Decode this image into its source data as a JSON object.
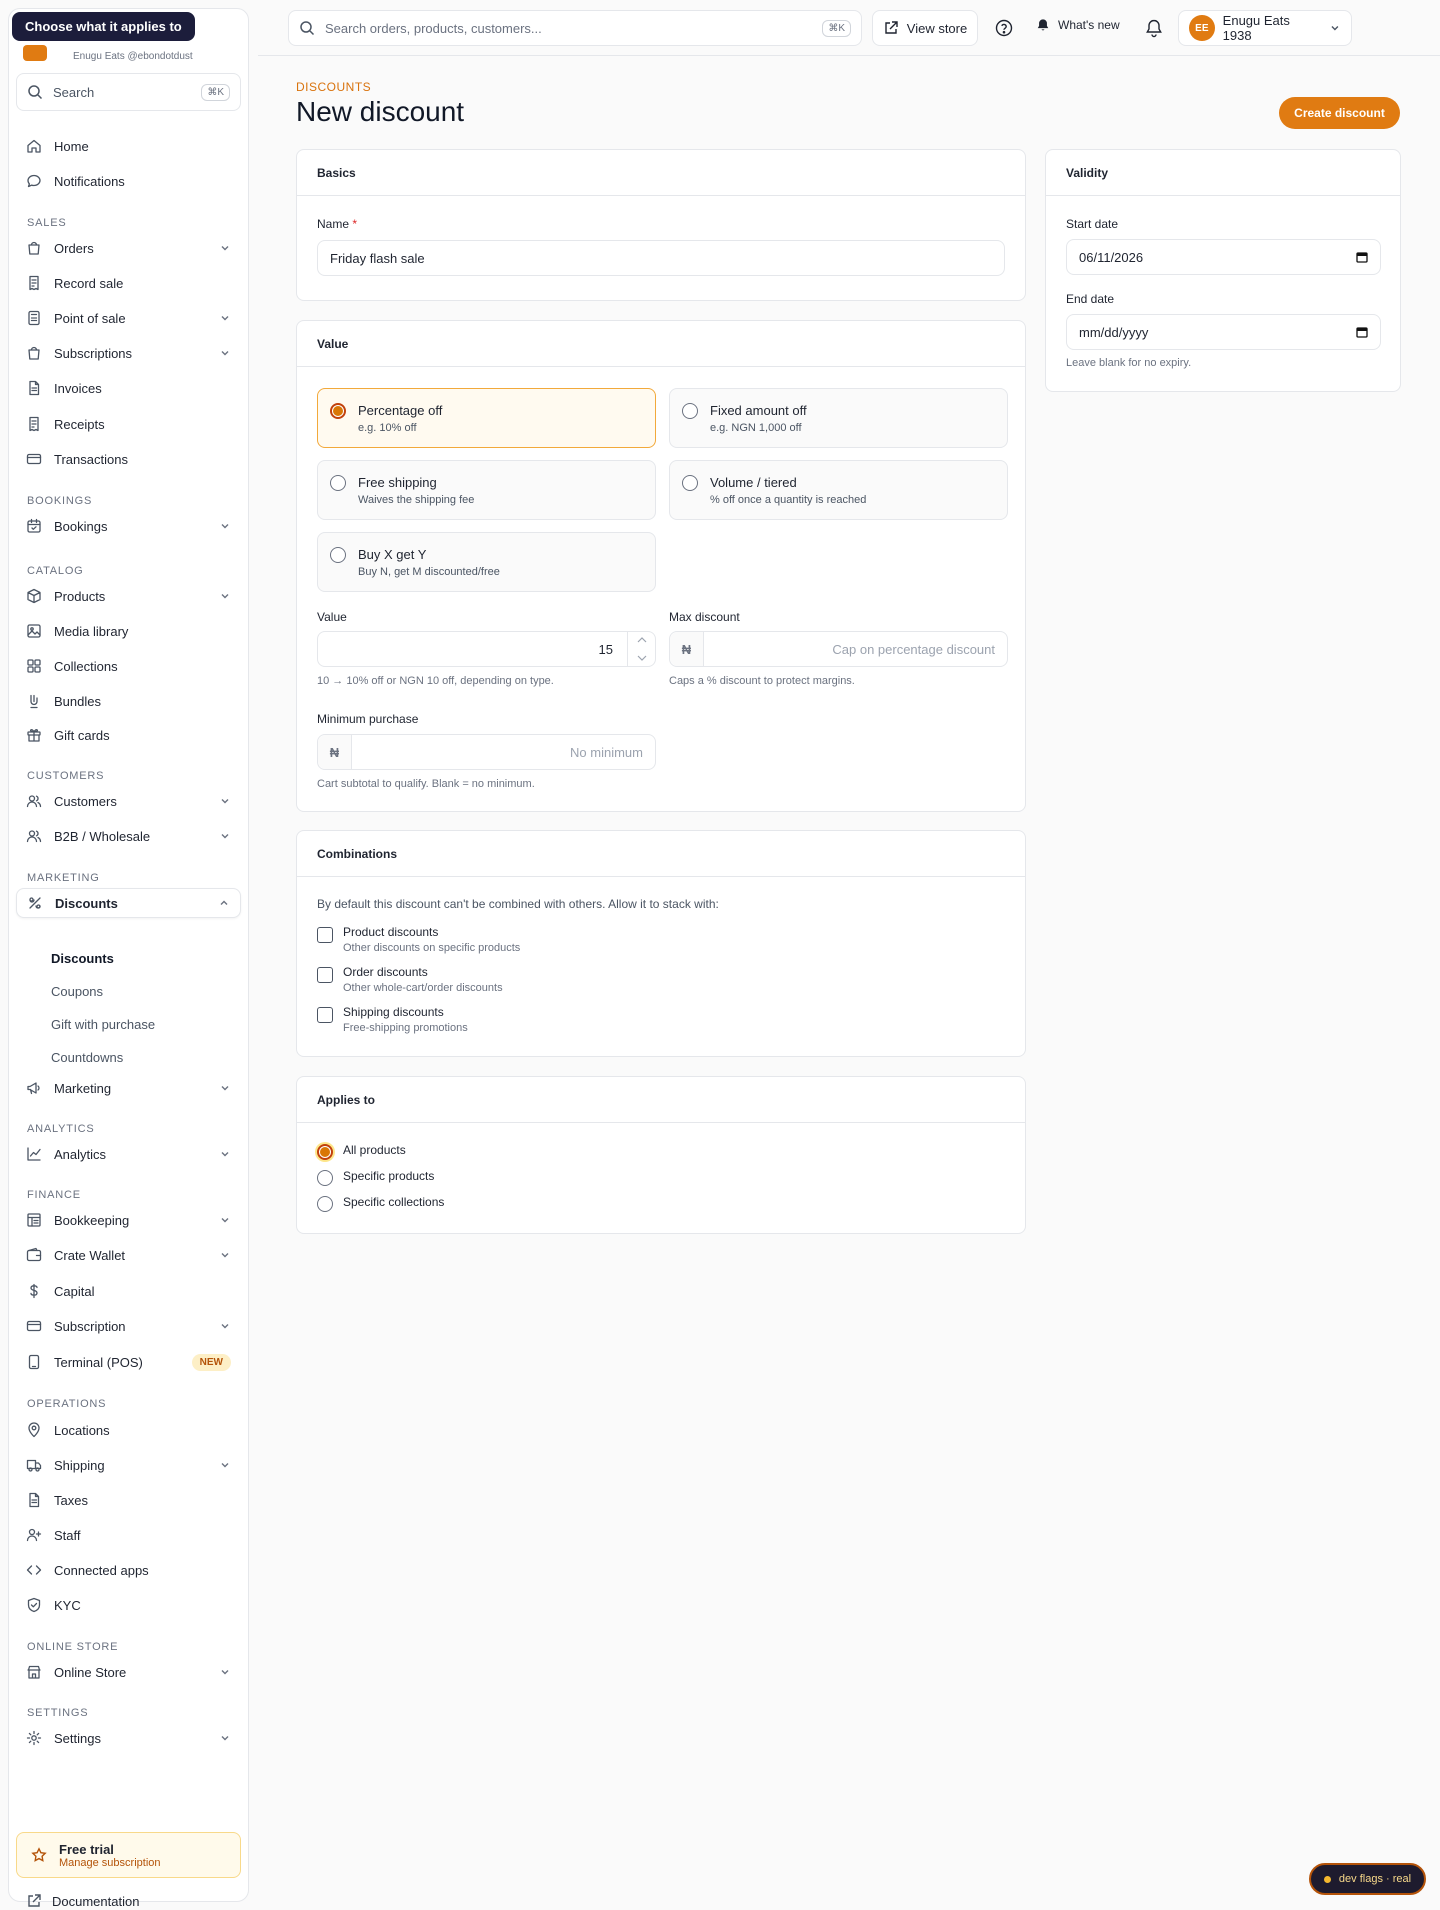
{
  "tooltip": "Choose what it applies to",
  "brand": {
    "subtitle": "Enugu Eats @ebondotdust"
  },
  "sidebar": {
    "search_label": "Search",
    "search_kbd": "⌘K",
    "items": [
      {
        "label": "Home",
        "icon": "home-icon"
      },
      {
        "label": "Notifications",
        "icon": "chat-bubble-icon"
      },
      {
        "section": "SALES"
      },
      {
        "label": "Orders",
        "icon": "bag-icon",
        "chevron": true
      },
      {
        "label": "Record sale",
        "icon": "receipt-icon"
      },
      {
        "label": "Point of sale",
        "icon": "pos-icon",
        "chevron": true
      },
      {
        "label": "Subscriptions",
        "icon": "bag-icon",
        "chevron": true
      },
      {
        "label": "Invoices",
        "icon": "document-icon"
      },
      {
        "label": "Receipts",
        "icon": "receipt-icon"
      },
      {
        "label": "Transactions",
        "icon": "card-icon"
      },
      {
        "section": "BOOKINGS"
      },
      {
        "label": "Bookings",
        "icon": "calendar-icon",
        "chevron": true
      },
      {
        "section": "CATALOG"
      },
      {
        "label": "Products",
        "icon": "box-icon",
        "chevron": true
      },
      {
        "label": "Media library",
        "icon": "image-icon"
      },
      {
        "label": "Collections",
        "icon": "grid-icon"
      },
      {
        "label": "Bundles",
        "icon": "bundle-icon"
      },
      {
        "label": "Gift cards",
        "icon": "gift-icon"
      },
      {
        "section": "CUSTOMERS"
      },
      {
        "label": "Customers",
        "icon": "users-icon",
        "chevron": true
      },
      {
        "label": "B2B / Wholesale",
        "icon": "users-icon",
        "chevron": true
      },
      {
        "section": "MARKETING"
      },
      {
        "label": "Discounts",
        "icon": "percent-icon",
        "chevron": true,
        "active": true
      },
      {
        "label": "Marketing",
        "icon": "megaphone-icon",
        "chevron": true
      },
      {
        "section": "ANALYTICS"
      },
      {
        "label": "Analytics",
        "icon": "chart-icon",
        "chevron": true
      },
      {
        "section": "FINANCE"
      },
      {
        "label": "Bookkeeping",
        "icon": "ledger-icon",
        "chevron": true
      },
      {
        "label": "Crate Wallet",
        "icon": "wallet-icon",
        "chevron": true
      },
      {
        "label": "Capital",
        "icon": "dollar-icon"
      },
      {
        "label": "Subscription",
        "icon": "card-icon",
        "chevron": true
      },
      {
        "label": "Terminal (POS)",
        "icon": "terminal-icon",
        "badge": "NEW"
      },
      {
        "section": "OPERATIONS"
      },
      {
        "label": "Locations",
        "icon": "pin-icon"
      },
      {
        "label": "Shipping",
        "icon": "truck-icon",
        "chevron": true
      },
      {
        "label": "Taxes",
        "icon": "document-icon"
      },
      {
        "label": "Staff",
        "icon": "user-plus-icon"
      },
      {
        "label": "Connected apps",
        "icon": "code-icon"
      },
      {
        "label": "KYC",
        "icon": "shield-icon"
      },
      {
        "section": "ONLINE STORE"
      },
      {
        "label": "Online Store",
        "icon": "store-icon",
        "chevron": true
      },
      {
        "section": "SETTINGS"
      },
      {
        "label": "Settings",
        "icon": "gear-icon",
        "chevron": true
      }
    ],
    "discount_sub": [
      "Discounts",
      "Coupons",
      "Gift with purchase",
      "Countdowns"
    ],
    "trial": {
      "title": "Free trial",
      "subtitle": "Manage subscription"
    },
    "documentation": "Documentation"
  },
  "topbar": {
    "search_placeholder": "Search orders, products, customers...",
    "search_kbd": "⌘K",
    "view_store": "View store",
    "whats_new": "What's new",
    "store_initials": "EE",
    "store_name": "Enugu Eats 1938"
  },
  "page": {
    "eyebrow": "DISCOUNTS",
    "title": "New discount",
    "create_button": "Create discount"
  },
  "basics": {
    "title": "Basics",
    "name_label": "Name",
    "required_mark": "*",
    "name_value": "Friday flash sale"
  },
  "value_card": {
    "title": "Value",
    "options": [
      {
        "title": "Percentage off",
        "desc": "e.g. 10% off",
        "selected": true
      },
      {
        "title": "Fixed amount off",
        "desc": "e.g. NGN 1,000 off",
        "selected": false
      },
      {
        "title": "Free shipping",
        "desc": "Waives the shipping fee",
        "selected": false
      },
      {
        "title": "Volume / tiered",
        "desc": "% off once a quantity is reached",
        "selected": false
      },
      {
        "title": "Buy X get Y",
        "desc": "Buy N, get M discounted/free",
        "selected": false
      }
    ],
    "value_label": "Value",
    "value_input": "15",
    "value_help": "10 → 10% off or NGN 10 off, depending on type.",
    "max_label": "Max discount",
    "currency_symbol": "₦",
    "max_placeholder": "Cap on percentage discount",
    "max_help": "Caps a % discount to protect margins.",
    "min_label": "Minimum purchase",
    "min_placeholder": "No minimum",
    "min_help": "Cart subtotal to qualify. Blank = no minimum."
  },
  "combinations": {
    "title": "Combinations",
    "intro": "By default this discount can't be combined with others. Allow it to stack with:",
    "items": [
      {
        "title": "Product discounts",
        "desc": "Other discounts on specific products",
        "checked": false
      },
      {
        "title": "Order discounts",
        "desc": "Other whole-cart/order discounts",
        "checked": false
      },
      {
        "title": "Shipping discounts",
        "desc": "Free-shipping promotions",
        "checked": false
      }
    ]
  },
  "applies": {
    "title": "Applies to",
    "options": [
      {
        "label": "All products",
        "selected": true
      },
      {
        "label": "Specific products",
        "selected": false
      },
      {
        "label": "Specific collections",
        "selected": false
      }
    ]
  },
  "validity": {
    "title": "Validity",
    "start_label": "Start date",
    "start_value": "06/11/2026",
    "end_label": "End date",
    "end_placeholder": "mm/dd/yyyy",
    "end_help": "Leave blank for no expiry."
  },
  "devflags": "dev flags · real",
  "colors": {
    "accent": "#e07b12",
    "tooltip_bg": "#1c1d3b"
  }
}
